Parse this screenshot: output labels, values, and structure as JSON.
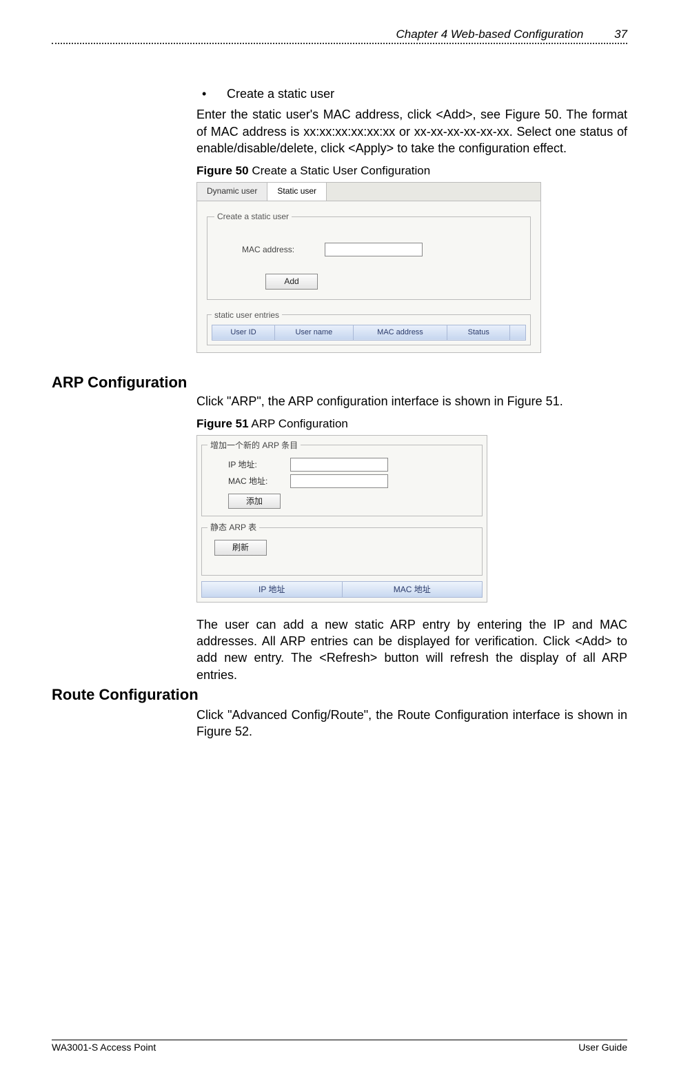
{
  "header": {
    "chapter": "Chapter 4 Web-based Configuration",
    "page_number": "37"
  },
  "bullet": {
    "dot": "•",
    "text": "Create a static user"
  },
  "para1": "Enter the static user's MAC address, click <Add>, see Figure 50. The format of MAC address is xx:xx:xx:xx:xx:xx or xx-xx-xx-xx-xx-xx. Select one status of enable/disable/delete, click <Apply> to take the configuration effect.",
  "fig50": {
    "caption_bold": "Figure 50",
    "caption_rest": " Create a Static User Configuration",
    "tab_dynamic": "Dynamic user",
    "tab_static": "Static user",
    "fieldset_create": "Create a static user",
    "mac_label": "MAC address:",
    "add_btn": "Add",
    "fieldset_entries": "static user entries",
    "cols": {
      "c1": "User ID",
      "c2": "User name",
      "c3": "MAC address",
      "c4": "Status"
    }
  },
  "arp_heading": "ARP Configuration",
  "arp_intro": "Click \"ARP\", the ARP configuration interface is shown in Figure 51.",
  "fig51": {
    "caption_bold": "Figure 51",
    "caption_rest": " ARP Configuration",
    "fieldset_add": "增加一个新的 ARP 条目",
    "ip_label": "IP 地址:",
    "mac_label": "MAC 地址:",
    "add_btn": "添加",
    "fieldset_table": "静态 ARP 表",
    "refresh_btn": "刷新",
    "col_ip": "IP 地址",
    "col_mac": "MAC 地址"
  },
  "arp_body": "The user can add a new static ARP entry by entering the IP and MAC addresses. All ARP entries can be displayed for verification. Click <Add> to add new entry. The <Refresh> button will refresh the display of all ARP entries.",
  "route_heading": "Route Configuration",
  "route_body": "Click \"Advanced Config/Route\", the Route Configuration interface is shown in Figure 52.",
  "footer": {
    "left": "WA3001-S Access Point",
    "right": "User Guide"
  }
}
